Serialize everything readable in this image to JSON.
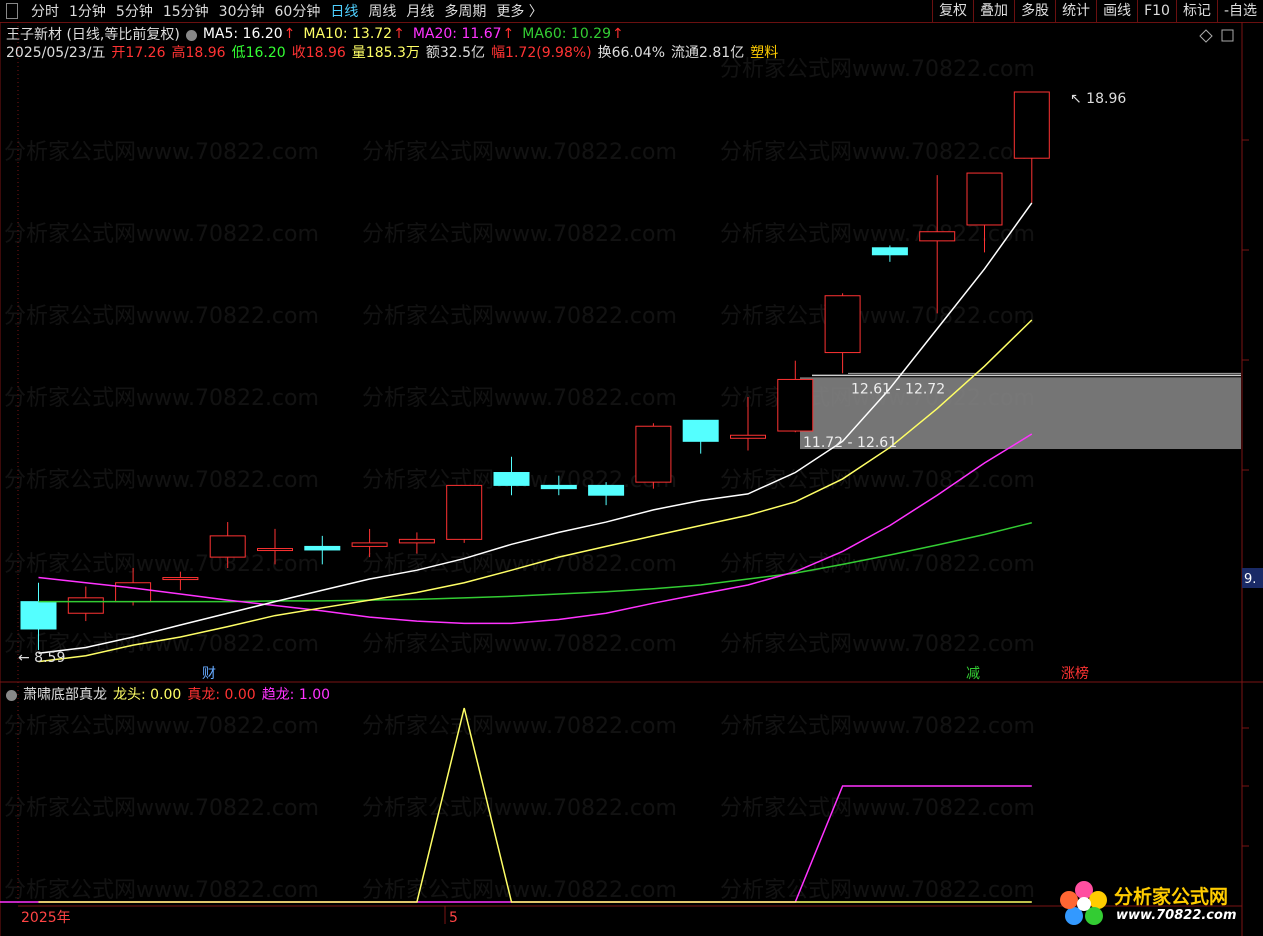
{
  "toolbar": {
    "periods": [
      "分时",
      "1分钟",
      "5分钟",
      "15分钟",
      "30分钟",
      "60分钟",
      "日线",
      "周线",
      "月线",
      "多周期",
      "更多 〉"
    ],
    "active_index": 6,
    "buttons": [
      "复权",
      "叠加",
      "多股",
      "统计",
      "画线",
      "F10",
      "标记",
      "-自选"
    ]
  },
  "legend": {
    "stock": "王子新材 (日线,等比前复权)",
    "ma5_label": "MA5: 16.20",
    "ma10_label": "MA10: 13.72",
    "ma20_label": "MA20: 11.67",
    "ma60_label": "MA60: 10.29",
    "arrow": "↑",
    "date": "2025/05/23/五",
    "open": "开17.26",
    "high": "高18.96",
    "low": "低16.20",
    "close": "收18.96",
    "volume": "量185.3万",
    "amount": "额32.5亿",
    "amplitude": "幅1.72(9.98%)",
    "turnover": "换66.04%",
    "float": "流通2.81亿",
    "sector": "塑料"
  },
  "indicator": {
    "name": "萧啸底部真龙",
    "l1": "龙头: 0.00",
    "l2": "真龙: 0.00",
    "l3": "趋龙: 1.00"
  },
  "annotations": {
    "high_price": "18.96",
    "low_price": "8.59",
    "zone1": "12.61 - 12.72",
    "zone2": "11.72 - 12.61",
    "axis_value": "9.",
    "marker_cai": "财",
    "marker_jian": "减",
    "marker_zhangbang": "涨榜"
  },
  "xaxis": {
    "year": "2025年",
    "month": "5"
  },
  "watermark": "分析家公式网www.70822.com",
  "logo": {
    "title": "分析家公式网",
    "url": "www.70822.com"
  },
  "colors": {
    "up": "#ff3333",
    "down": "#54ffff",
    "ma5": "#ffffff",
    "ma10": "#ffff66",
    "ma20": "#ff33ff",
    "ma60": "#33cc33",
    "frame": "#7a1414"
  },
  "chart_data": {
    "type": "candlestick",
    "candles": [
      {
        "o": 9.2,
        "h": 9.45,
        "l": 8.59,
        "c": 8.85
      },
      {
        "o": 9.05,
        "h": 9.4,
        "l": 8.95,
        "c": 9.25
      },
      {
        "o": 9.2,
        "h": 9.65,
        "l": 9.15,
        "c": 9.45
      },
      {
        "o": 9.5,
        "h": 9.6,
        "l": 9.35,
        "c": 9.52
      },
      {
        "o": 9.8,
        "h": 10.3,
        "l": 9.65,
        "c": 10.1
      },
      {
        "o": 9.9,
        "h": 10.2,
        "l": 9.7,
        "c": 9.92
      },
      {
        "o": 9.95,
        "h": 10.1,
        "l": 9.7,
        "c": 9.9
      },
      {
        "o": 9.95,
        "h": 10.2,
        "l": 9.8,
        "c": 10.0
      },
      {
        "o": 10.0,
        "h": 10.15,
        "l": 9.85,
        "c": 10.05
      },
      {
        "o": 10.05,
        "h": 10.8,
        "l": 10.0,
        "c": 10.85
      },
      {
        "o": 11.05,
        "h": 11.3,
        "l": 10.7,
        "c": 10.85
      },
      {
        "o": 10.85,
        "h": 11.0,
        "l": 10.7,
        "c": 10.8
      },
      {
        "o": 10.85,
        "h": 10.9,
        "l": 10.55,
        "c": 10.7
      },
      {
        "o": 10.9,
        "h": 11.85,
        "l": 10.8,
        "c": 11.8
      },
      {
        "o": 11.9,
        "h": 11.9,
        "l": 11.35,
        "c": 11.55
      },
      {
        "o": 11.6,
        "h": 12.3,
        "l": 11.4,
        "c": 11.65
      },
      {
        "o": 11.72,
        "h": 12.95,
        "l": 11.7,
        "c": 12.61
      },
      {
        "o": 13.1,
        "h": 14.25,
        "l": 12.72,
        "c": 14.2
      },
      {
        "o": 15.2,
        "h": 15.25,
        "l": 14.9,
        "c": 15.05
      },
      {
        "o": 15.35,
        "h": 16.85,
        "l": 13.85,
        "c": 15.55
      },
      {
        "o": 15.7,
        "h": 16.9,
        "l": 15.1,
        "c": 16.9
      },
      {
        "o": 17.26,
        "h": 18.96,
        "l": 16.2,
        "c": 18.96
      }
    ],
    "ma5": [
      8.55,
      8.62,
      8.75,
      8.9,
      9.05,
      9.2,
      9.35,
      9.5,
      9.62,
      9.78,
      9.98,
      10.15,
      10.3,
      10.48,
      10.62,
      10.72,
      11.05,
      11.55,
      12.45,
      13.55,
      14.75,
      16.2
    ],
    "ma10": [
      8.45,
      8.52,
      8.65,
      8.75,
      8.88,
      9.02,
      9.12,
      9.22,
      9.32,
      9.45,
      9.62,
      9.8,
      9.95,
      10.1,
      10.25,
      10.4,
      10.6,
      10.95,
      11.45,
      12.1,
      12.85,
      13.72
    ],
    "ma20": [
      9.52,
      9.45,
      9.38,
      9.3,
      9.22,
      9.15,
      9.08,
      9.0,
      8.95,
      8.92,
      8.92,
      8.97,
      9.05,
      9.18,
      9.3,
      9.42,
      9.6,
      9.88,
      10.25,
      10.7,
      11.2,
      11.67
    ],
    "ma60": [
      9.2,
      9.2,
      9.2,
      9.2,
      9.2,
      9.21,
      9.21,
      9.22,
      9.23,
      9.25,
      9.27,
      9.3,
      9.33,
      9.37,
      9.42,
      9.5,
      9.58,
      9.7,
      9.83,
      9.97,
      10.12,
      10.29
    ],
    "indicator_yellow": [
      0,
      0,
      0,
      0,
      0,
      0,
      0,
      0,
      0,
      1,
      0,
      0,
      0,
      0,
      0,
      0,
      0,
      0,
      0,
      0,
      0,
      0
    ],
    "indicator_purple": [
      0,
      0,
      0,
      0,
      0,
      0,
      0,
      0,
      0,
      0,
      0,
      0,
      0,
      0,
      0,
      0,
      0,
      1,
      1,
      1,
      1,
      1
    ],
    "ylim": [
      8.0,
      20.0
    ]
  }
}
